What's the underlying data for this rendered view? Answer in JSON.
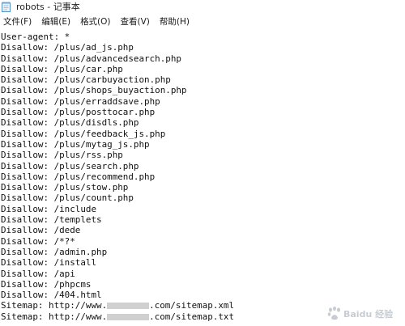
{
  "window": {
    "title": "robots - 记事本"
  },
  "menu": {
    "items": [
      {
        "label": "文件(F)"
      },
      {
        "label": "编辑(E)"
      },
      {
        "label": "格式(O)"
      },
      {
        "label": "查看(V)"
      },
      {
        "label": "帮助(H)"
      }
    ]
  },
  "document": {
    "lines": [
      "User-agent: *",
      "Disallow: /plus/ad_js.php",
      "Disallow: /plus/advancedsearch.php",
      "Disallow: /plus/car.php",
      "Disallow: /plus/carbuyaction.php",
      "Disallow: /plus/shops_buyaction.php",
      "Disallow: /plus/erraddsave.php",
      "Disallow: /plus/posttocar.php",
      "Disallow: /plus/disdls.php",
      "Disallow: /plus/feedback_js.php",
      "Disallow: /plus/mytag_js.php",
      "Disallow: /plus/rss.php",
      "Disallow: /plus/search.php",
      "Disallow: /plus/recommend.php",
      "Disallow: /plus/stow.php",
      "Disallow: /plus/count.php",
      "Disallow: /include",
      "Disallow: /templets",
      "Disallow: /dede",
      "Disallow: /*?*",
      "Disallow: /admin.php",
      "Disallow: /install",
      "Disallow: /api",
      "Disallow: /phpcms",
      "Disallow: /404.html"
    ],
    "sitemaps": [
      {
        "prefix": "Sitemap: http://www.",
        "suffix": ".com/sitemap.xml"
      },
      {
        "prefix": "Sitemap: http://www.",
        "suffix": ".com/sitemap.txt"
      }
    ]
  },
  "watermark": {
    "text": "Baidu 经验"
  }
}
